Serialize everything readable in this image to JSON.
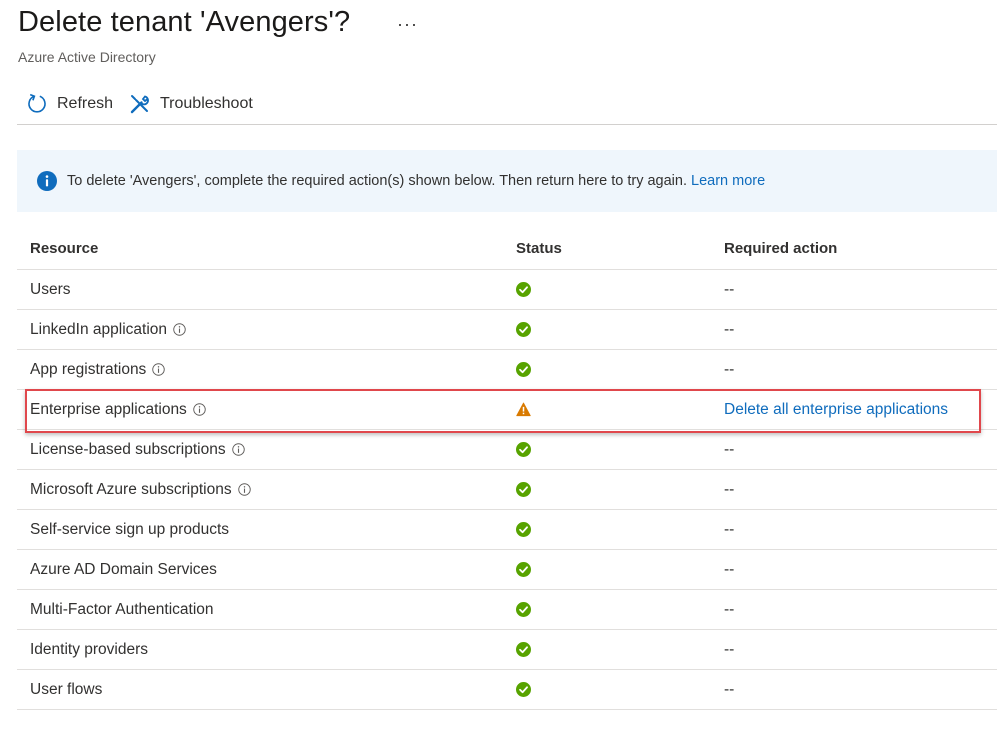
{
  "header": {
    "title": "Delete tenant 'Avengers'?",
    "more_label": "···",
    "subtitle": "Azure Active Directory"
  },
  "toolbar": {
    "refresh_label": "Refresh",
    "troubleshoot_label": "Troubleshoot"
  },
  "banner": {
    "message": "To delete 'Avengers', complete the required action(s) shown below. Then return here to try again.",
    "link_label": "Learn more"
  },
  "table": {
    "headers": {
      "resource": "Resource",
      "status": "Status",
      "action": "Required action"
    },
    "rows": [
      {
        "resource": "Users",
        "info": false,
        "status": "ok",
        "action": "--"
      },
      {
        "resource": "LinkedIn application",
        "info": true,
        "status": "ok",
        "action": "--"
      },
      {
        "resource": "App registrations",
        "info": true,
        "status": "ok",
        "action": "--"
      },
      {
        "resource": "Enterprise applications",
        "info": true,
        "status": "warning",
        "action": "Delete all enterprise applications"
      },
      {
        "resource": "License-based subscriptions",
        "info": true,
        "status": "ok",
        "action": "--"
      },
      {
        "resource": "Microsoft Azure subscriptions",
        "info": true,
        "status": "ok",
        "action": "--"
      },
      {
        "resource": "Self-service sign up products",
        "info": false,
        "status": "ok",
        "action": "--"
      },
      {
        "resource": "Azure AD Domain Services",
        "info": false,
        "status": "ok",
        "action": "--"
      },
      {
        "resource": "Multi-Factor Authentication",
        "info": false,
        "status": "ok",
        "action": "--"
      },
      {
        "resource": "Identity providers",
        "info": false,
        "status": "ok",
        "action": "--"
      },
      {
        "resource": "User flows",
        "info": false,
        "status": "ok",
        "action": "--"
      }
    ]
  },
  "colors": {
    "success": "#57a300",
    "warning": "#d97a00",
    "link": "#0f6cbd",
    "info": "#0f6cbd",
    "highlight": "#e0474c"
  }
}
